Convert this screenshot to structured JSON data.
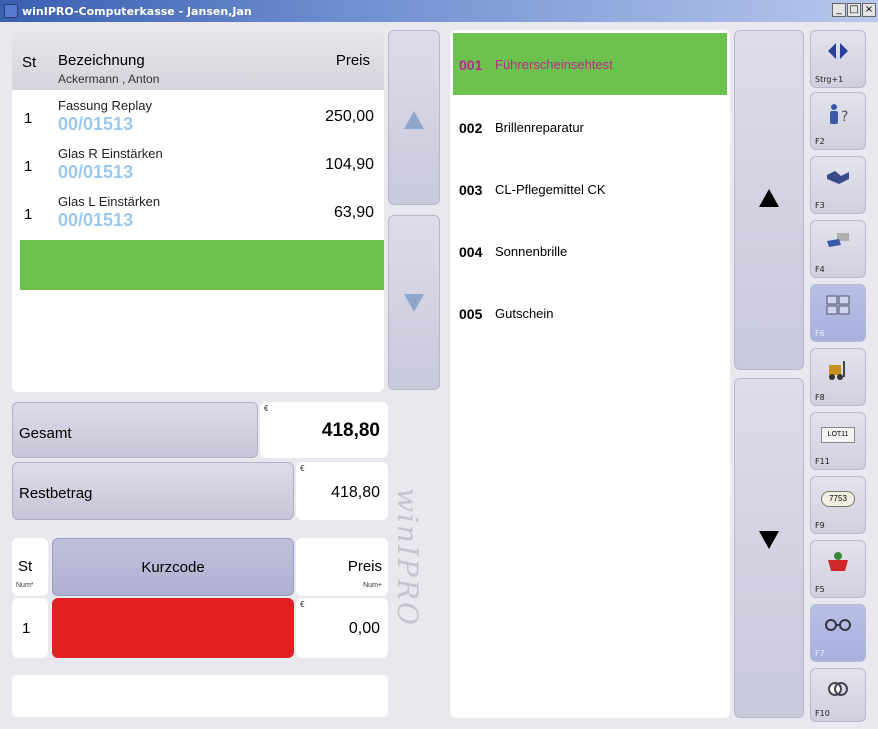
{
  "window": {
    "title": "winIPRO-Computerkasse - Jansen,Jan",
    "buttons": [
      "_",
      "□",
      "×"
    ]
  },
  "order": {
    "col_st": "St",
    "col_bezeichnung": "Bezeichnung",
    "col_preis": "Preis",
    "customer": "Ackermann , Anton",
    "items": [
      {
        "qty": "1",
        "name": "Fassung Replay",
        "code": "00/01513",
        "price": "250,00"
      },
      {
        "qty": "1",
        "name": "Glas R Einstärken",
        "code": "00/01513",
        "price": "104,90"
      },
      {
        "qty": "1",
        "name": "Glas L Einstärken",
        "code": "00/01513",
        "price": "63,90"
      }
    ]
  },
  "totals": {
    "gesamt_label": "Gesamt",
    "gesamt_value": "418,80",
    "rest_label": "Restbetrag",
    "rest_value": "418,80",
    "currency": "€"
  },
  "entry": {
    "st_label": "St",
    "st_sub": "Num*",
    "kurzcode_label": "Kurzcode",
    "preis_label": "Preis",
    "preis_sub": "Num+",
    "qty_value": "1",
    "price_value": "0,00",
    "currency": "€"
  },
  "watermark": "winIPRO",
  "products": [
    {
      "code": "001",
      "name": "Führerscheinsehtest",
      "selected": true
    },
    {
      "code": "002",
      "name": "Brillenreparatur"
    },
    {
      "code": "003",
      "name": "CL-Pflegemittel CK"
    },
    {
      "code": "004",
      "name": "Sonnenbrille"
    },
    {
      "code": "005",
      "name": "Gutschein"
    }
  ],
  "function_keys": [
    {
      "label": "Strg+1",
      "icon": "arrows-left-right-icon"
    },
    {
      "label": "F2",
      "icon": "person-question-icon"
    },
    {
      "label": "F3",
      "icon": "handshake-icon"
    },
    {
      "label": "F4",
      "icon": "hand-card-icon"
    },
    {
      "label": "F6",
      "icon": "calendar-grid-icon",
      "active": true
    },
    {
      "label": "F8",
      "icon": "forklift-icon"
    },
    {
      "label": "F11",
      "icon": "lot-label-icon",
      "text": "LOT11"
    },
    {
      "label": "F9",
      "icon": "tag-label-icon",
      "text": "7753"
    },
    {
      "label": "F5",
      "icon": "basket-icon"
    },
    {
      "label": "F7",
      "icon": "glasses-icon",
      "active": true
    },
    {
      "label": "F10",
      "icon": "contact-lens-icon"
    }
  ],
  "colors": {
    "accent_green": "#6dc24f",
    "selected_text": "#b8298c",
    "code_blue": "#9cc8ee",
    "entry_red": "#e02020"
  }
}
